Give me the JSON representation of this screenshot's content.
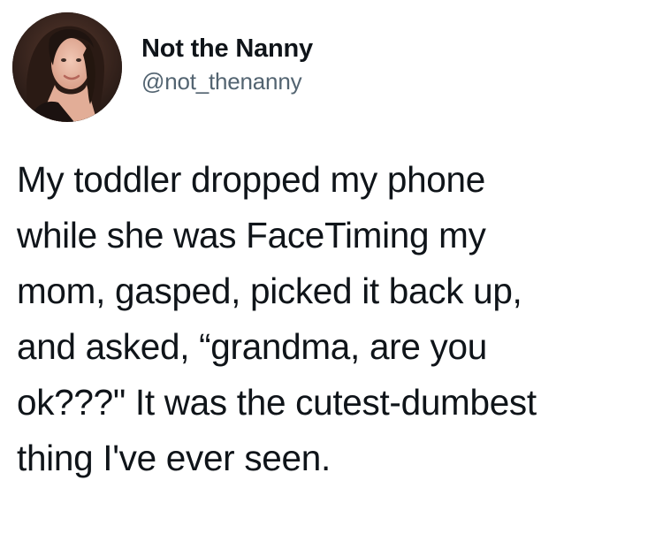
{
  "author": {
    "display_name": "Not the Nanny",
    "handle": "@not_thenanny"
  },
  "tweet": {
    "lines": [
      "My toddler dropped my phone",
      "while she was FaceTiming my",
      "mom, gasped, picked it back up,",
      "and asked, “grandma, are you",
      "ok???\" It was the cutest-dumbest",
      "thing I've ever seen."
    ]
  },
  "colors": {
    "name_text": "#0f1419",
    "handle_text": "#536471",
    "background": "#ffffff"
  }
}
